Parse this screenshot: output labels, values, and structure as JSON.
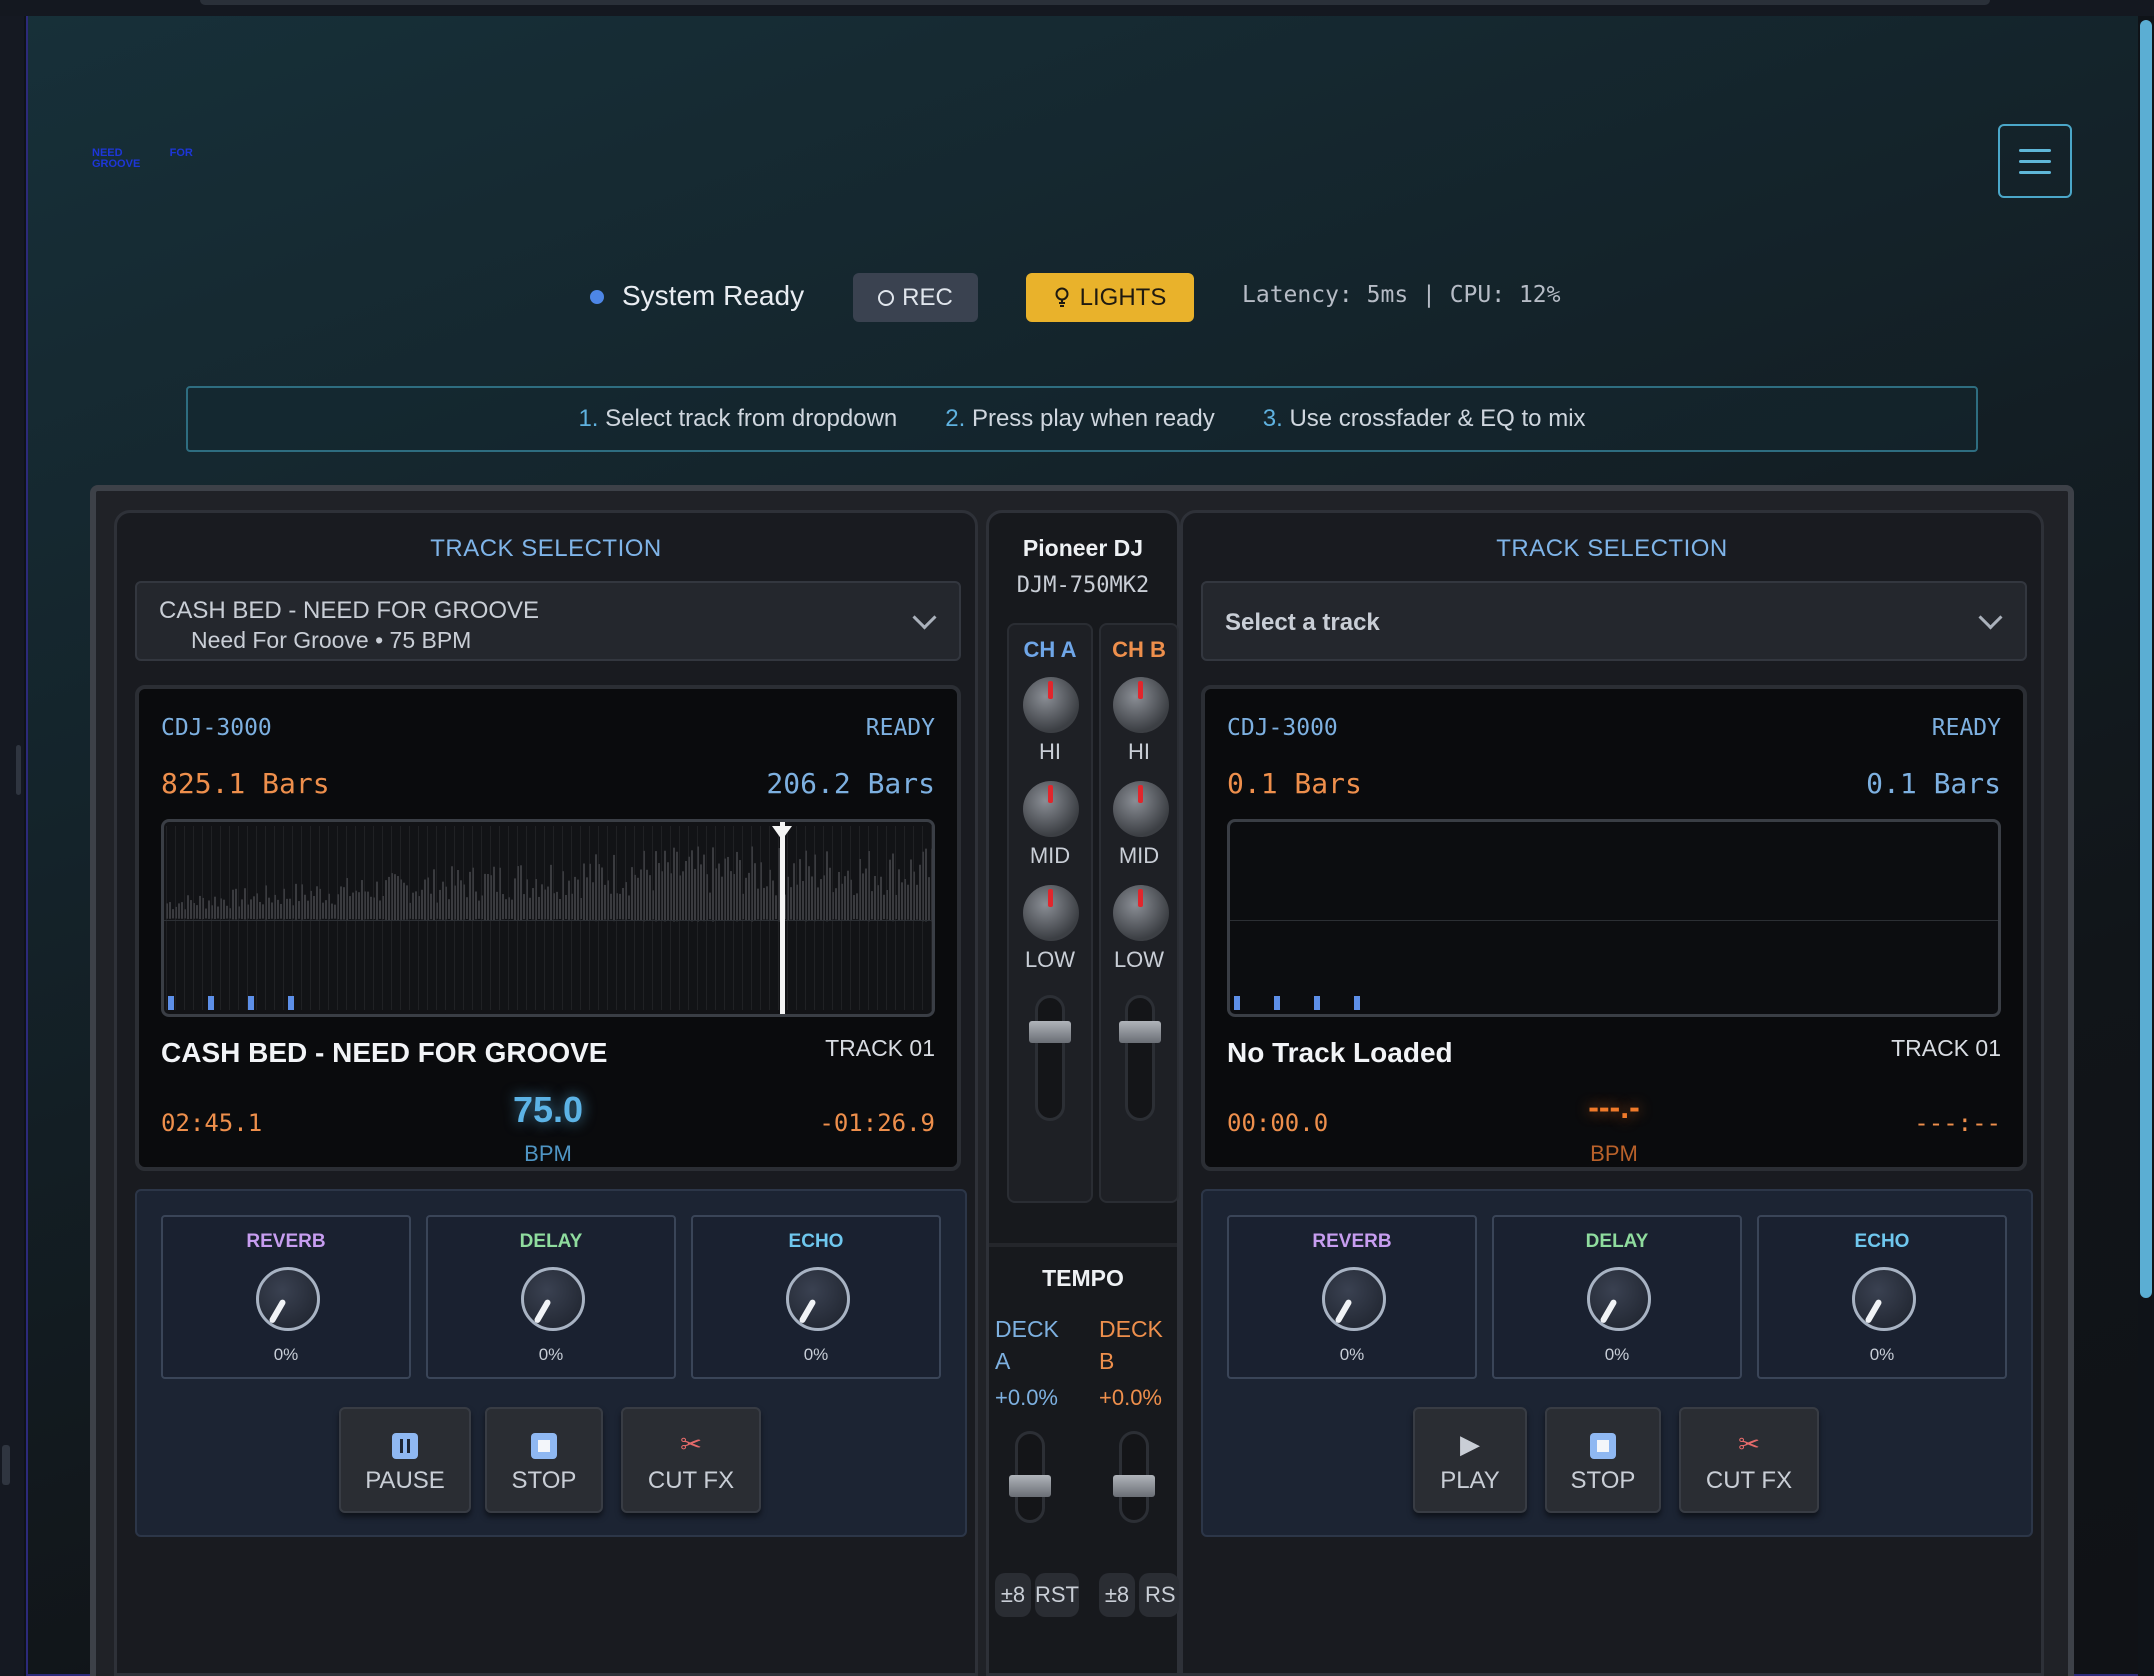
{
  "logo": {
    "word1": "NEED",
    "word2": "FOR",
    "word3": "GROOVE"
  },
  "status": {
    "text": "System Ready",
    "rec_label": "REC",
    "lights_label": "LIGHTS",
    "latency": "Latency: 5ms | CPU: 12%"
  },
  "steps": [
    {
      "num": "1.",
      "text": "Select track from dropdown"
    },
    {
      "num": "2.",
      "text": "Press play when ready"
    },
    {
      "num": "3.",
      "text": "Use crossfader & EQ to mix"
    }
  ],
  "deck_a": {
    "title": "TRACK SELECTION",
    "select_line1": "CASH BED - NEED FOR GROOVE",
    "select_line2": "Need For Groove • 75 BPM",
    "cdj": "CDJ-3000",
    "state": "READY",
    "bars_left": "825.1 Bars",
    "bars_right": "206.2 Bars",
    "track_name": "CASH BED - NEED FOR GROOVE",
    "track_no": "TRACK 01",
    "elapsed": "02:45.1",
    "bpm": "75.0",
    "bpm_label": "BPM",
    "remaining": "-01:26.9",
    "progress": 0.8,
    "fx": [
      {
        "name": "REVERB",
        "value": "0%",
        "color": "#c79df0"
      },
      {
        "name": "DELAY",
        "value": "0%",
        "color": "#8fdc9e"
      },
      {
        "name": "ECHO",
        "value": "0%",
        "color": "#6fc7ee"
      }
    ],
    "buttons": [
      {
        "icon": "pause-icon",
        "label": "PAUSE"
      },
      {
        "icon": "stop-icon",
        "label": "STOP"
      },
      {
        "icon": "scissors-icon",
        "label": "CUT FX"
      }
    ]
  },
  "deck_b": {
    "title": "TRACK SELECTION",
    "select_placeholder": "Select a track",
    "cdj": "CDJ-3000",
    "state": "READY",
    "bars_left": "0.1 Bars",
    "bars_right": "0.1 Bars",
    "track_name": "No Track Loaded",
    "track_no": "TRACK 01",
    "elapsed": "00:00.0",
    "bpm": "---.-",
    "bpm_label": "BPM",
    "remaining": "---:--",
    "fx": [
      {
        "name": "REVERB",
        "value": "0%",
        "color": "#c79df0"
      },
      {
        "name": "DELAY",
        "value": "0%",
        "color": "#8fdc9e"
      },
      {
        "name": "ECHO",
        "value": "0%",
        "color": "#6fc7ee"
      }
    ],
    "buttons": [
      {
        "icon": "play-icon",
        "label": "PLAY"
      },
      {
        "icon": "stop-icon",
        "label": "STOP"
      },
      {
        "icon": "scissors-icon",
        "label": "CUT FX"
      }
    ]
  },
  "mixer": {
    "brand": "Pioneer DJ",
    "model": "DJM-750MK2",
    "ch_a": "CH A",
    "ch_b": "CH B",
    "eq_hi": "HI",
    "eq_mid": "MID",
    "eq_low": "LOW",
    "tempo_title": "TEMPO",
    "deck_a_label": "DECK A",
    "deck_b_label": "DECK B",
    "deck_a_tempo": "+0.0%",
    "deck_b_tempo": "+0.0%",
    "range_label": "±8",
    "reset_a": "RST",
    "reset_b": "RS"
  },
  "colors": {
    "accent_blue": "#7db0e0",
    "accent_orange": "#ee8f4c",
    "lights_yellow": "#e9b22b",
    "bpm_blue": "#5cb3e6",
    "bpm_orange": "#f07a2a"
  }
}
